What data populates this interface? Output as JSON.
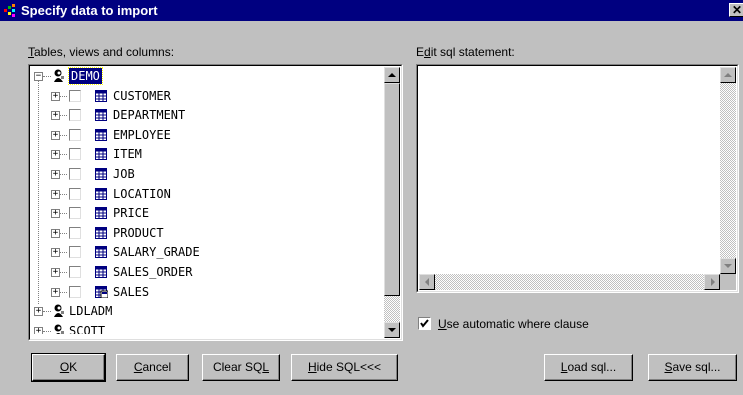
{
  "window": {
    "title": "Specify data to import",
    "close_label": "✕"
  },
  "left_panel": {
    "label_accesskey": "T",
    "label_rest": "ables, views and columns:"
  },
  "right_panel": {
    "label_prefix": "E",
    "label_accesskey": "d",
    "label_rest": "it sql statement:",
    "sql_text": ""
  },
  "tree": {
    "schemas": [
      {
        "name": "DEMO",
        "expanded": true,
        "selected": true,
        "tables": [
          "CUSTOMER",
          "DEPARTMENT",
          "EMPLOYEE",
          "ITEM",
          "JOB",
          "LOCATION",
          "PRICE",
          "PRODUCT",
          "SALARY_GRADE",
          "SALES_ORDER",
          "SALES"
        ]
      },
      {
        "name": "LDLADM",
        "expanded": false
      },
      {
        "name": "SCOTT",
        "expanded": false
      }
    ]
  },
  "auto_where": {
    "checked": true,
    "accesskey": "U",
    "rest": "se automatic where clause"
  },
  "buttons": {
    "ok_key": "O",
    "ok_rest": "K",
    "cancel_key": "C",
    "cancel_rest": "ancel",
    "clear_prefix": "Clear SQ",
    "clear_key": "L",
    "hide_key": "H",
    "hide_rest": "ide SQL<<<",
    "load_key": "L",
    "load_rest": "oad sql...",
    "save_key": "S",
    "save_rest": "ave sql..."
  }
}
